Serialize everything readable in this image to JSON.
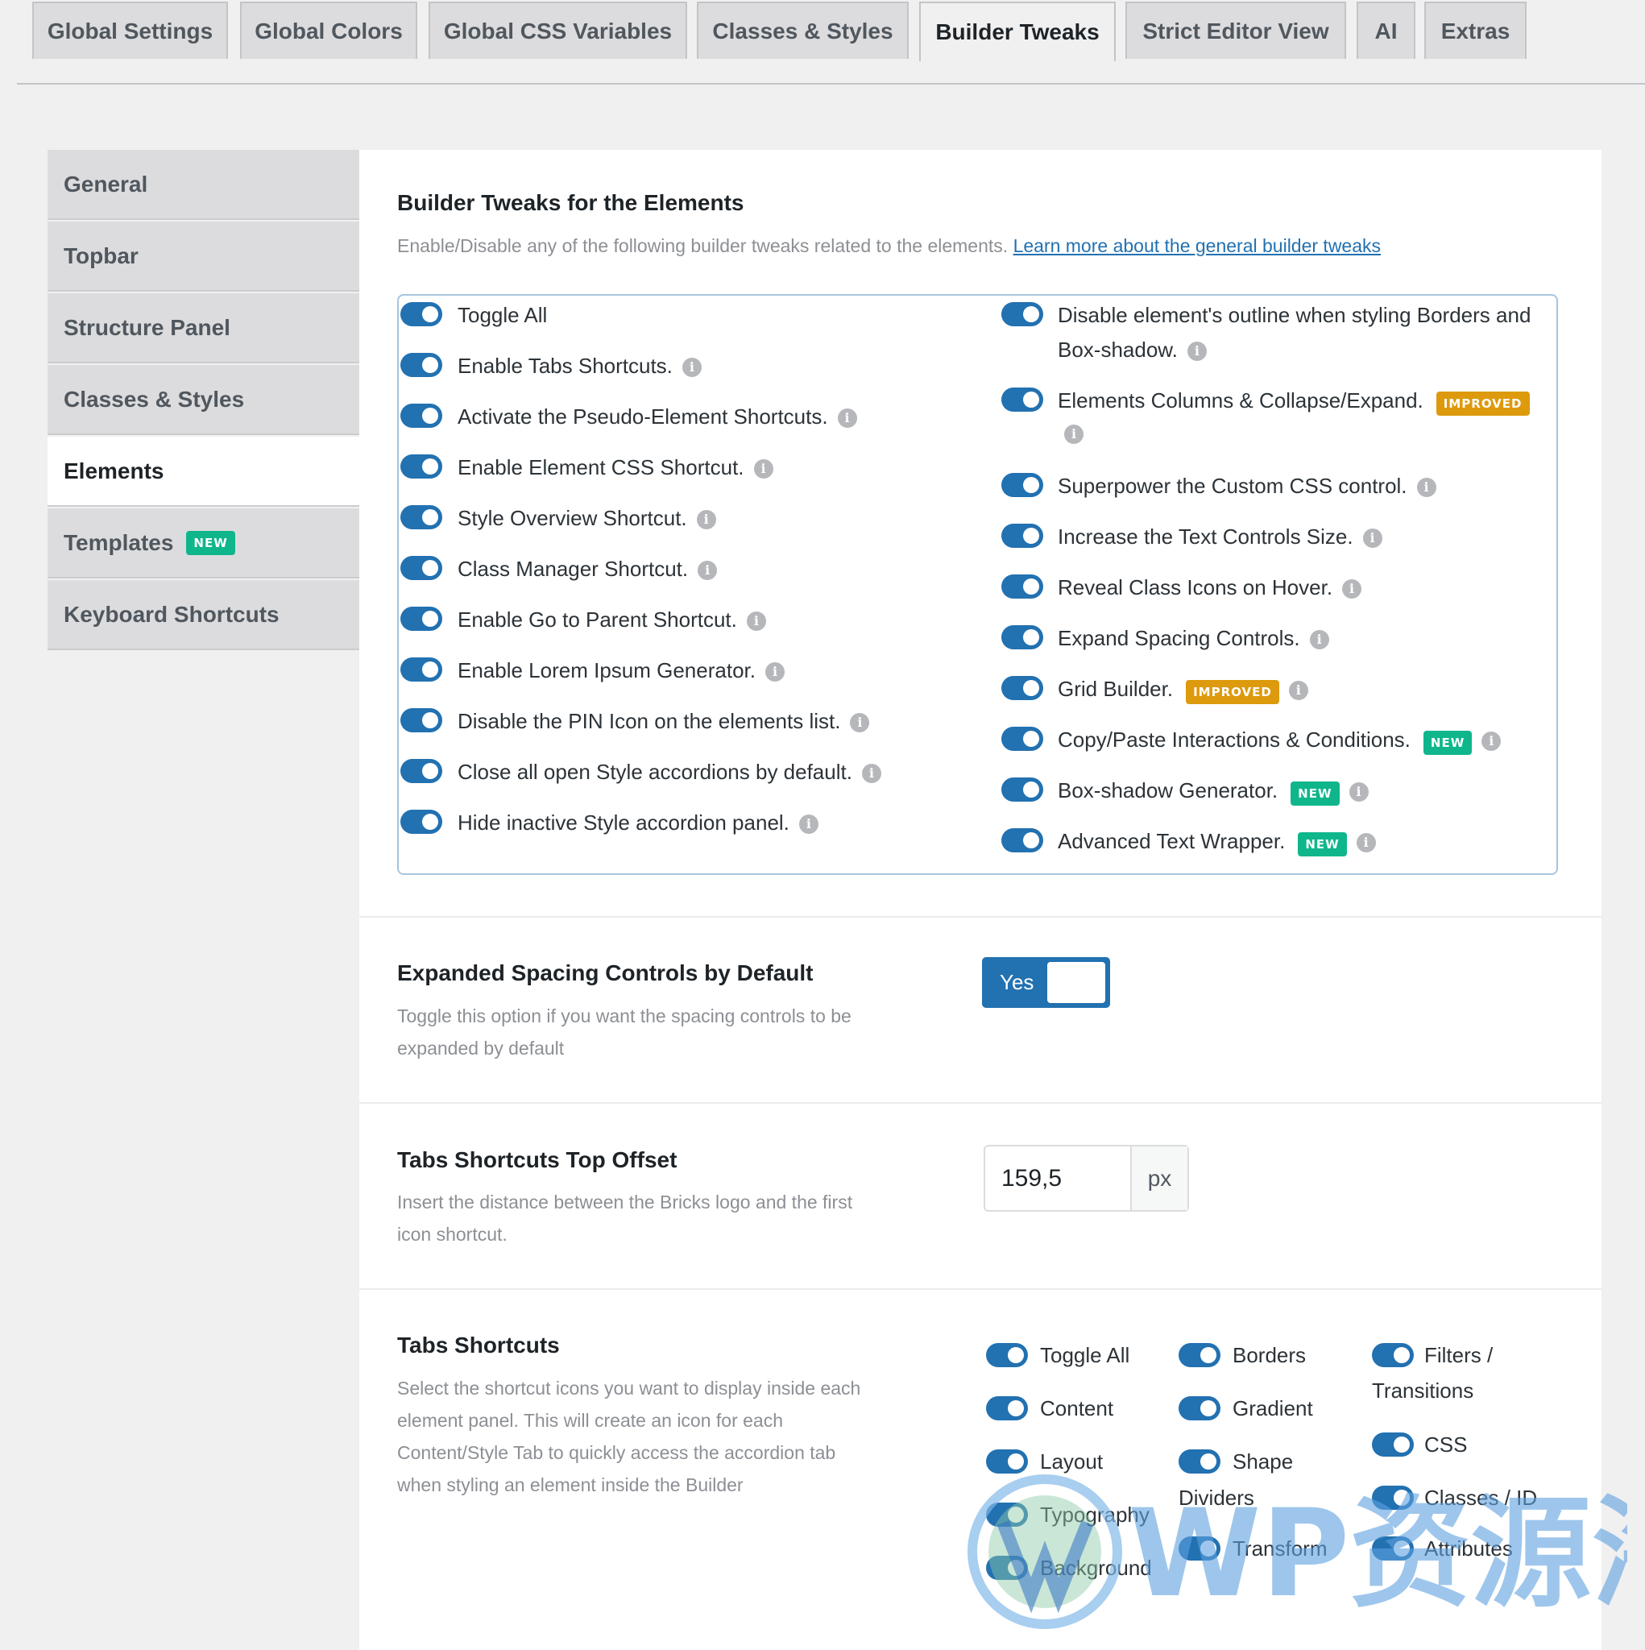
{
  "top_tabs": [
    {
      "label": "Global Settings"
    },
    {
      "label": "Global Colors"
    },
    {
      "label": "Global CSS Variables"
    },
    {
      "label": "Classes & Styles"
    },
    {
      "label": "Builder Tweaks"
    },
    {
      "label": "Strict Editor View"
    },
    {
      "label": "AI"
    },
    {
      "label": "Extras"
    }
  ],
  "sidebar": {
    "items": [
      {
        "label": "General"
      },
      {
        "label": "Topbar"
      },
      {
        "label": "Structure Panel"
      },
      {
        "label": "Classes & Styles"
      },
      {
        "label": "Elements"
      },
      {
        "label": "Templates",
        "badge": "NEW"
      },
      {
        "label": "Keyboard Shortcuts"
      }
    ],
    "active": "Elements"
  },
  "elements_section": {
    "title": "Builder Tweaks for the Elements",
    "description": "Enable/Disable any of the following builder tweaks related to the elements.",
    "link_text": "Learn more about the general builder tweaks",
    "left_items": [
      {
        "label": "Toggle All",
        "on": true
      },
      {
        "label": "Enable Tabs Shortcuts.",
        "on": true
      },
      {
        "label": "Activate the Pseudo-Element Shortcuts.",
        "on": true
      },
      {
        "label": "Enable Element CSS Shortcut.",
        "on": true
      },
      {
        "label": "Style Overview Shortcut.",
        "on": true
      },
      {
        "label": "Class Manager Shortcut.",
        "on": true
      },
      {
        "label": "Enable Go to Parent Shortcut.",
        "on": true
      },
      {
        "label": "Enable Lorem Ipsum Generator.",
        "on": true
      },
      {
        "label": "Disable the PIN Icon on the elements list.",
        "on": true
      },
      {
        "label": "Close all open Style accordions by default.",
        "on": true
      },
      {
        "label": "Hide inactive Style accordion panel.",
        "on": true
      }
    ],
    "right_items": [
      {
        "label_line1": "Disable element's outline when styling Borders and",
        "label_line2": "Box-shadow.",
        "on": true
      },
      {
        "label": "Elements Columns & Collapse/Expand.",
        "badge": "IMPROVED",
        "on": true
      },
      {
        "label": "Superpower the Custom CSS control.",
        "on": true
      },
      {
        "label": "Increase the Text Controls Size.",
        "on": true
      },
      {
        "label": "Reveal Class Icons on Hover.",
        "on": true
      },
      {
        "label": "Expand Spacing Controls.",
        "on": true
      },
      {
        "label": "Grid Builder.",
        "badge": "IMPROVED",
        "on": true
      },
      {
        "label": "Copy/Paste Interactions & Conditions.",
        "badge": "NEW",
        "on": true
      },
      {
        "label": "Box-shadow Generator.",
        "badge": "NEW",
        "on": true
      },
      {
        "label": "Advanced Text Wrapper.",
        "badge": "NEW",
        "on": true
      }
    ]
  },
  "expanded_spacing": {
    "title": "Expanded Spacing Controls by Default",
    "description_line1": "Toggle this option if you want the spacing controls to be",
    "description_line2": "expanded by default",
    "toggle_label": "Yes"
  },
  "tabs_offset": {
    "title": "Tabs Shortcuts Top Offset",
    "description_line1": "Insert the distance between the Bricks logo and the first",
    "description_line2": "icon shortcut.",
    "value": "159,5",
    "unit": "px"
  },
  "tabs_shortcuts": {
    "title": "Tabs Shortcuts",
    "description_lines": [
      "Select the shortcut icons you want to display inside each",
      "element panel. This will create an icon for each",
      "Content/Style Tab to quickly access the accordion tab",
      "when styling an element inside the Builder"
    ],
    "col1": [
      "Toggle All",
      "Content",
      "Layout",
      "Typography",
      "Background"
    ],
    "col2": [
      "Borders",
      "Gradient",
      "Shape",
      "Dividers",
      "Transform"
    ],
    "col3": [
      "Filters /",
      "Transitions",
      "CSS",
      "Classes / ID",
      "Attributes"
    ]
  },
  "watermark": {
    "text": "WP资源海"
  },
  "colors": {
    "accent": "#2271b1",
    "new_badge": "#0fb68c",
    "improved_badge": "#dd9a0d"
  }
}
